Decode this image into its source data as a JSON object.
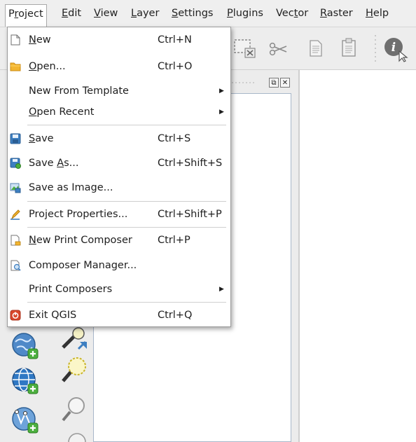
{
  "menubar": {
    "items": [
      {
        "pre": "P",
        "mn": "r",
        "post": "oject"
      },
      {
        "pre": "",
        "mn": "E",
        "post": "dit"
      },
      {
        "pre": "",
        "mn": "V",
        "post": "iew"
      },
      {
        "pre": "",
        "mn": "L",
        "post": "ayer"
      },
      {
        "pre": "",
        "mn": "S",
        "post": "ettings"
      },
      {
        "pre": "",
        "mn": "P",
        "post": "lugins"
      },
      {
        "pre": "Vec",
        "mn": "t",
        "post": "or"
      },
      {
        "pre": "",
        "mn": "R",
        "post": "aster"
      },
      {
        "pre": "",
        "mn": "H",
        "post": "elp"
      }
    ]
  },
  "project_menu": {
    "items": [
      {
        "icon": "new-document-icon",
        "pre": "",
        "mn": "N",
        "post": "ew",
        "shortcut": "Ctrl+N",
        "submenu": false
      },
      {
        "icon": "open-folder-icon",
        "pre": "",
        "mn": "O",
        "post": "pen...",
        "shortcut": "Ctrl+O",
        "submenu": false
      },
      {
        "icon": "",
        "pre": "New From Template",
        "mn": "",
        "post": "",
        "shortcut": "",
        "submenu": true
      },
      {
        "icon": "",
        "pre": "",
        "mn": "O",
        "post": "pen Recent",
        "shortcut": "",
        "submenu": true
      },
      {
        "icon": "save-icon",
        "pre": "",
        "mn": "S",
        "post": "ave",
        "shortcut": "Ctrl+S",
        "submenu": false
      },
      {
        "icon": "save-as-icon",
        "pre": "Save ",
        "mn": "A",
        "post": "s...",
        "shortcut": "Ctrl+Shift+S",
        "submenu": false
      },
      {
        "icon": "save-as-image-icon",
        "pre": "Save as Image...",
        "mn": "",
        "post": "",
        "shortcut": "",
        "submenu": false
      },
      {
        "icon": "project-properties-icon",
        "pre": "Project Properties...",
        "mn": "",
        "post": "",
        "shortcut": "Ctrl+Shift+P",
        "submenu": false
      },
      {
        "icon": "new-print-composer-icon",
        "pre": "",
        "mn": "N",
        "post": "ew Print Composer",
        "shortcut": "Ctrl+P",
        "submenu": false
      },
      {
        "icon": "composer-manager-icon",
        "pre": "Composer Manager...",
        "mn": "",
        "post": "",
        "shortcut": "",
        "submenu": false
      },
      {
        "icon": "",
        "pre": "Print Composers",
        "mn": "",
        "post": "",
        "shortcut": "",
        "submenu": true
      },
      {
        "icon": "exit-icon",
        "pre": "Exit QGIS",
        "mn": "",
        "post": "",
        "shortcut": "Ctrl+Q",
        "submenu": false
      }
    ]
  },
  "icons": {
    "toolbar": [
      "select-rectangle-icon",
      "cut-icon",
      "copy-icon",
      "paste-icon",
      "identify-features-icon"
    ],
    "left_toolbar": [
      "add-wms-layer-icon",
      "zoom-to-layer-icon",
      "add-wcs-layer-icon",
      "zoom-to-selection-icon",
      "add-wfs-layer-icon",
      "zoom-out-icon"
    ]
  },
  "colors": {
    "accent_blue": "#3d7fc1",
    "folder_yellow": "#f3b530",
    "exit_red": "#d9472b",
    "add_green": "#4caf3e"
  }
}
